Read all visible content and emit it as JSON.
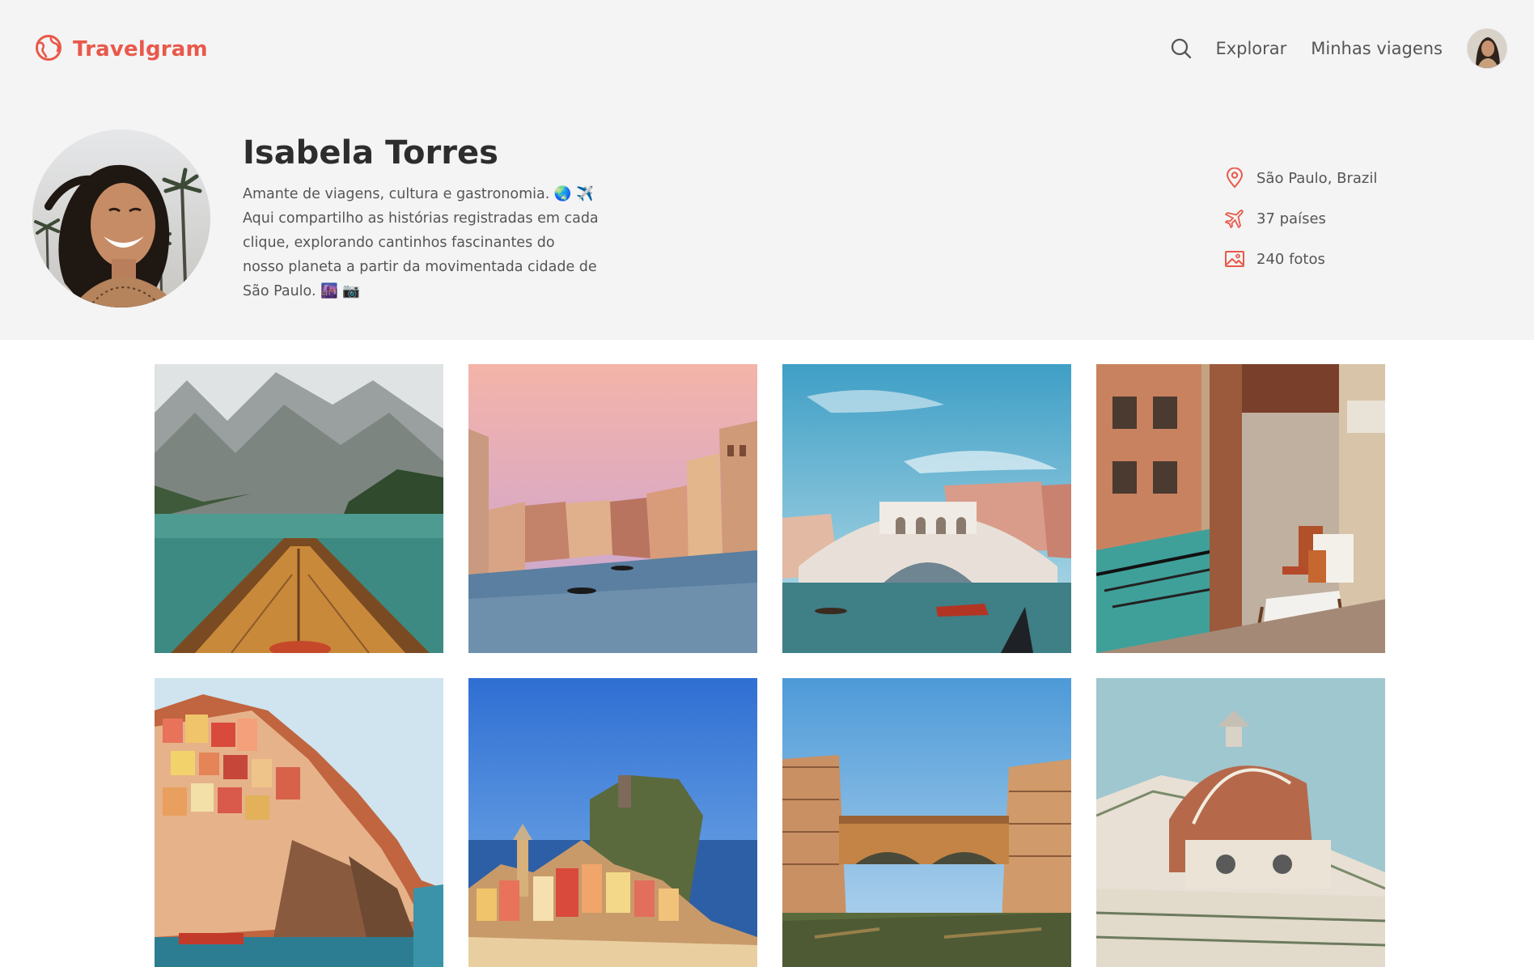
{
  "app": {
    "name": "Travelgram",
    "brand_color": "#e8594b"
  },
  "nav": {
    "search_icon": "search-icon",
    "links": [
      "Explorar",
      "Minhas viagens"
    ],
    "avatar": "user-avatar"
  },
  "profile": {
    "name": "Isabela Torres",
    "bio": "Amante de viagens, cultura e gastronomia. 🌏 ✈️ Aqui compartilho as histórias registradas em cada clique, explorando cantinhos fascinantes do nosso planeta a partir da movimentada cidade de São Paulo. 🌆 📷",
    "stats": [
      {
        "icon": "location-pin-icon",
        "text": "São Paulo, Brazil"
      },
      {
        "icon": "airplane-icon",
        "text": "37 países"
      },
      {
        "icon": "image-icon",
        "text": "240 fotos"
      }
    ]
  },
  "gallery": {
    "photos": [
      {
        "subject": "boat-on-mountain-lake"
      },
      {
        "subject": "venice-canal-sunset"
      },
      {
        "subject": "rialto-bridge"
      },
      {
        "subject": "venice-cafe-canal"
      },
      {
        "subject": "cinque-terre-manarola"
      },
      {
        "subject": "vernazza-coast"
      },
      {
        "subject": "ponte-vecchio"
      },
      {
        "subject": "florence-duomo"
      }
    ]
  }
}
